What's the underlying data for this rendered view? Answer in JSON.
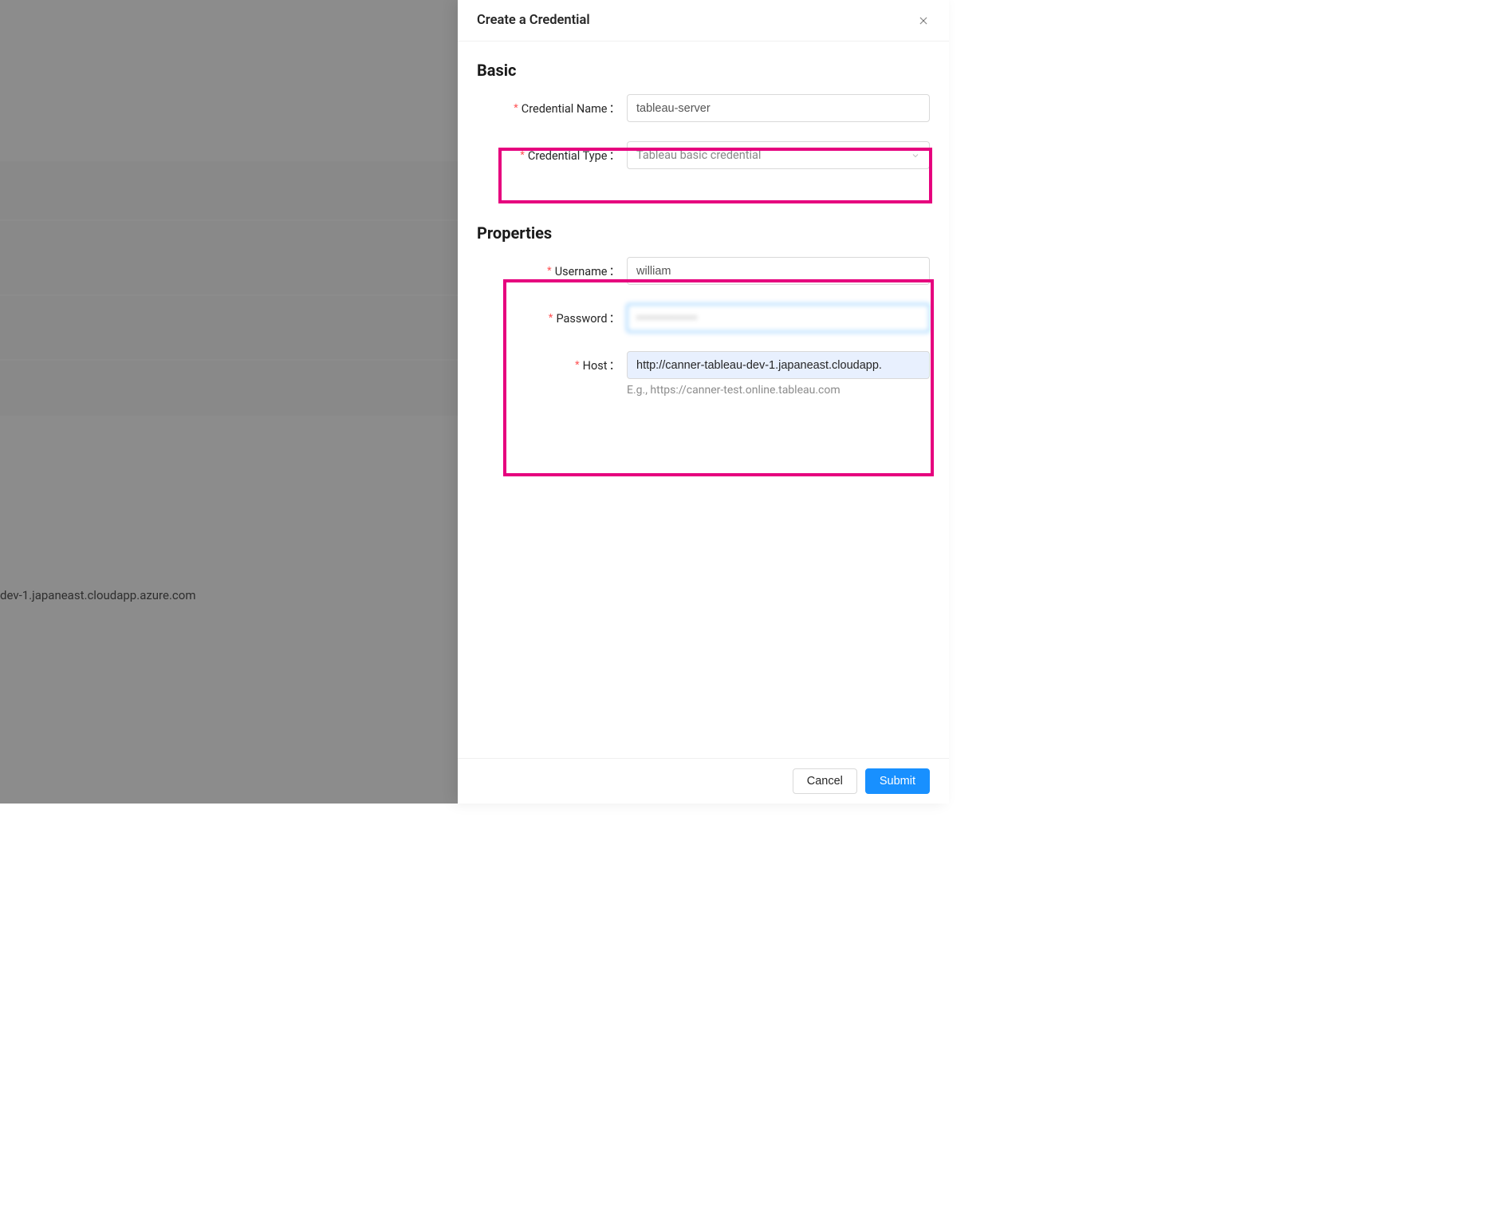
{
  "drawer": {
    "title": "Create a Credential",
    "sections": {
      "basic": {
        "heading": "Basic",
        "fields": {
          "credential_name": {
            "label": "Credential Name",
            "value": "tableau-server"
          },
          "credential_type": {
            "label": "Credential Type",
            "value": "Tableau basic credential"
          }
        }
      },
      "properties": {
        "heading": "Properties",
        "fields": {
          "username": {
            "label": "Username",
            "value": "william"
          },
          "password": {
            "label": "Password",
            "value": "••••••••••••••"
          },
          "host": {
            "label": "Host",
            "value": "http://canner-tableau-dev-1.japaneast.cloudapp.",
            "hint": "E.g., https://canner-test.online.tableau.com"
          }
        }
      }
    },
    "footer": {
      "cancel": "Cancel",
      "submit": "Submit"
    }
  },
  "background": {
    "host_fragment": "dev-1.japaneast.cloudapp.azure.com"
  }
}
